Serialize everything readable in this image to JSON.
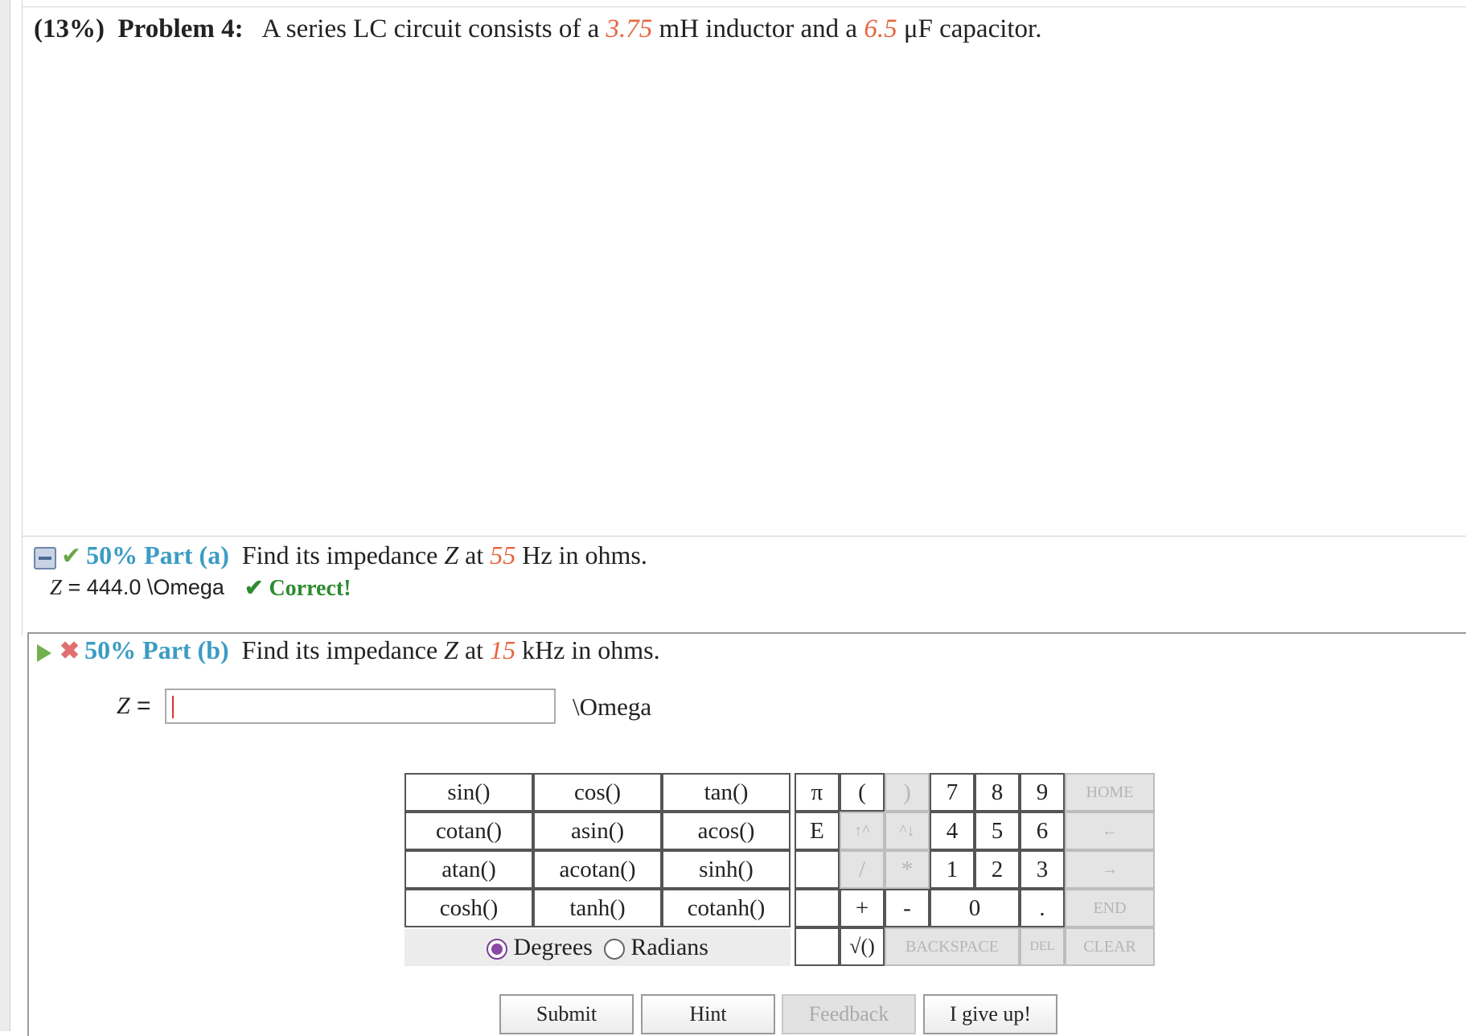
{
  "problem": {
    "weight": "(13%)",
    "label": "Problem 4:",
    "text_1": "A series LC circuit consists of a",
    "inductance": "3.75",
    "text_2": "mH inductor and a",
    "capacitance": "6.5",
    "text_3": "μF capacitor."
  },
  "part_a": {
    "weight": "50%",
    "label": "Part (a)",
    "text_1": "Find its impedance",
    "var": "Z",
    "text_2": "at",
    "freq": "55",
    "text_3": "Hz in ohms.",
    "answer_var": "Z",
    "answer_text": " = 444.0 \\Omega",
    "status": "✔ Correct!"
  },
  "part_b": {
    "weight": "50%",
    "label": "Part (b)",
    "text_1": "Find its impedance",
    "var": "Z",
    "text_2": "at",
    "freq": "15",
    "text_3": "kHz in ohms.",
    "input_var": "Z",
    "input_eq": " = ",
    "input_value": "",
    "unit": "\\Omega"
  },
  "keypad": {
    "functions": [
      "sin()",
      "cos()",
      "tan()",
      "cotan()",
      "asin()",
      "acos()",
      "atan()",
      "acotan()",
      "sinh()",
      "cosh()",
      "tanh()",
      "cotanh()"
    ],
    "pi": "π",
    "open_paren": "(",
    "close_paren": ")",
    "e": "E",
    "up_arrow": "↑^",
    "down_arrow": "^↓",
    "divide": "/",
    "multiply": "*",
    "plus": "+",
    "minus": "-",
    "sqrt": "√()",
    "digits": [
      "7",
      "8",
      "9",
      "4",
      "5",
      "6",
      "1",
      "2",
      "3",
      "0"
    ],
    "dot": ".",
    "home": "HOME",
    "left": "←",
    "right": "→",
    "end": "END",
    "backspace": "BACKSPACE",
    "del": "DEL",
    "clear": "CLEAR",
    "degrees": "Degrees",
    "radians": "Radians"
  },
  "buttons": {
    "submit": "Submit",
    "hint": "Hint",
    "feedback": "Feedback",
    "give_up": "I give up!"
  },
  "colors": {
    "highlight": "#e8643e",
    "part_label": "#3b9cc3",
    "correct": "#2e8b2e"
  }
}
